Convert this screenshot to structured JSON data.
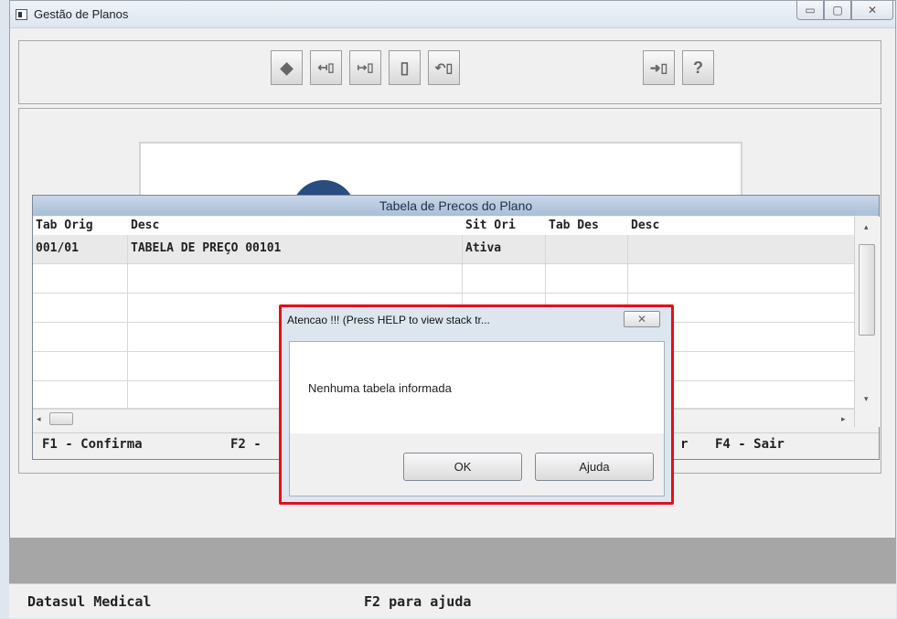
{
  "window": {
    "title": "Gestão de Planos"
  },
  "table_window": {
    "title": "Tabela de Precos do Plano",
    "columns": [
      "Tab Orig",
      "Desc",
      "Sit Ori",
      "Tab Des",
      "Desc"
    ],
    "rows": [
      [
        "001/01",
        "TABELA DE PREÇO 00101",
        "Ativa",
        "",
        ""
      ]
    ],
    "fkeys": {
      "f1": "F1 - Confirma",
      "f2": "F2 -",
      "f3_partial": "r",
      "f4": "F4 - Sair"
    }
  },
  "statusbar": {
    "left": "Datasul Medical",
    "center": "F2 para ajuda"
  },
  "dialog": {
    "title": "Atencao !!! (Press HELP to view stack tr...",
    "message": "Nenhuma tabela informada",
    "ok_label": "OK",
    "help_label": "Ajuda",
    "highlight_color": "#e3101a"
  },
  "toolbar_icons": [
    "tag-icon",
    "import-icon",
    "export-icon",
    "copy-icon",
    "paste-icon",
    "exit-icon",
    "help-icon"
  ]
}
